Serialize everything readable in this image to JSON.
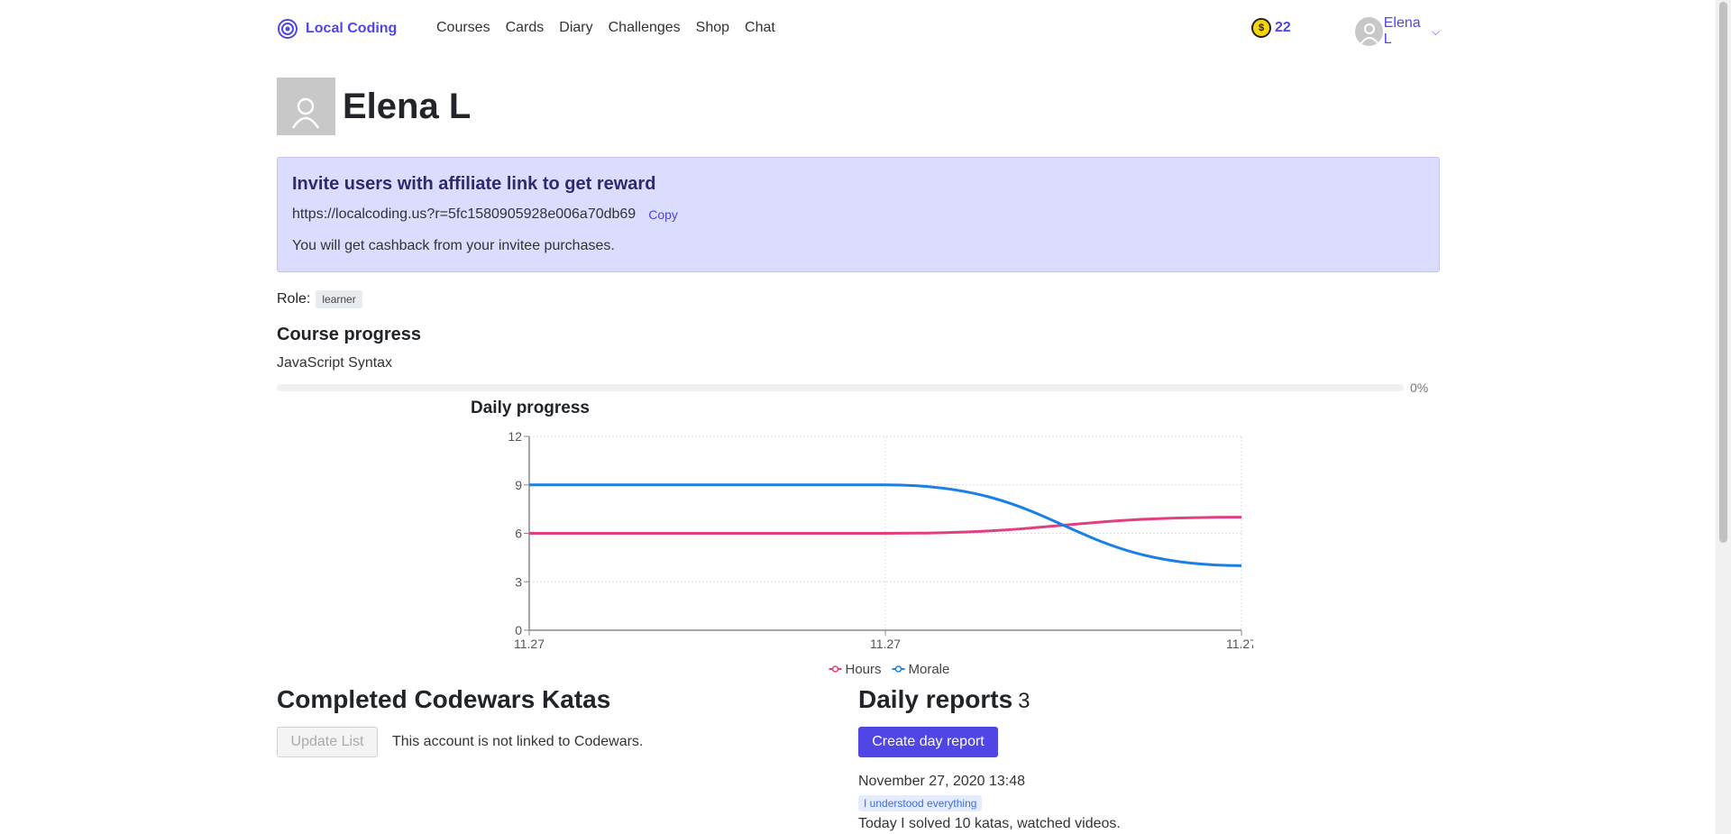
{
  "nav": {
    "brand": "Local Coding",
    "links": [
      "Courses",
      "Cards",
      "Diary",
      "Challenges",
      "Shop",
      "Chat"
    ],
    "coins": "22",
    "user_name": "Elena L"
  },
  "profile": {
    "name": "Elena L"
  },
  "affiliate": {
    "title": "Invite users with affiliate link to get reward",
    "link": "https://localcoding.us?r=5fc1580905928e006a70db69",
    "copy_label": "Copy",
    "note": "You will get cashback from your invitee purchases."
  },
  "role": {
    "label": "Role:",
    "value": "learner"
  },
  "course_progress": {
    "title": "Course progress",
    "course": "JavaScript Syntax",
    "percent_label": "0%",
    "percent": 0
  },
  "daily_progress": {
    "title": "Daily progress"
  },
  "chart_data": {
    "type": "line",
    "title": "Daily progress",
    "categories": [
      "11.27",
      "11.27",
      "11.27"
    ],
    "ylim": [
      0,
      12
    ],
    "yticks": [
      "0",
      "3",
      "6",
      "9",
      "12"
    ],
    "grid": true,
    "legend_position": "bottom",
    "series": [
      {
        "name": "Hours",
        "color": "#e0407f",
        "values": [
          6,
          6,
          7
        ]
      },
      {
        "name": "Morale",
        "color": "#1a7fe6",
        "values": [
          9,
          9,
          4
        ]
      }
    ]
  },
  "katas": {
    "title": "Completed Codewars Katas",
    "update_label": "Update List",
    "note": "This account is not linked to Codewars."
  },
  "reports": {
    "title": "Daily reports",
    "count": "3",
    "create_label": "Create day report",
    "items": [
      {
        "date": "November 27, 2020 13:48",
        "tag": "I understood everything",
        "text": "Today I solved 10 katas, watched videos."
      }
    ]
  }
}
